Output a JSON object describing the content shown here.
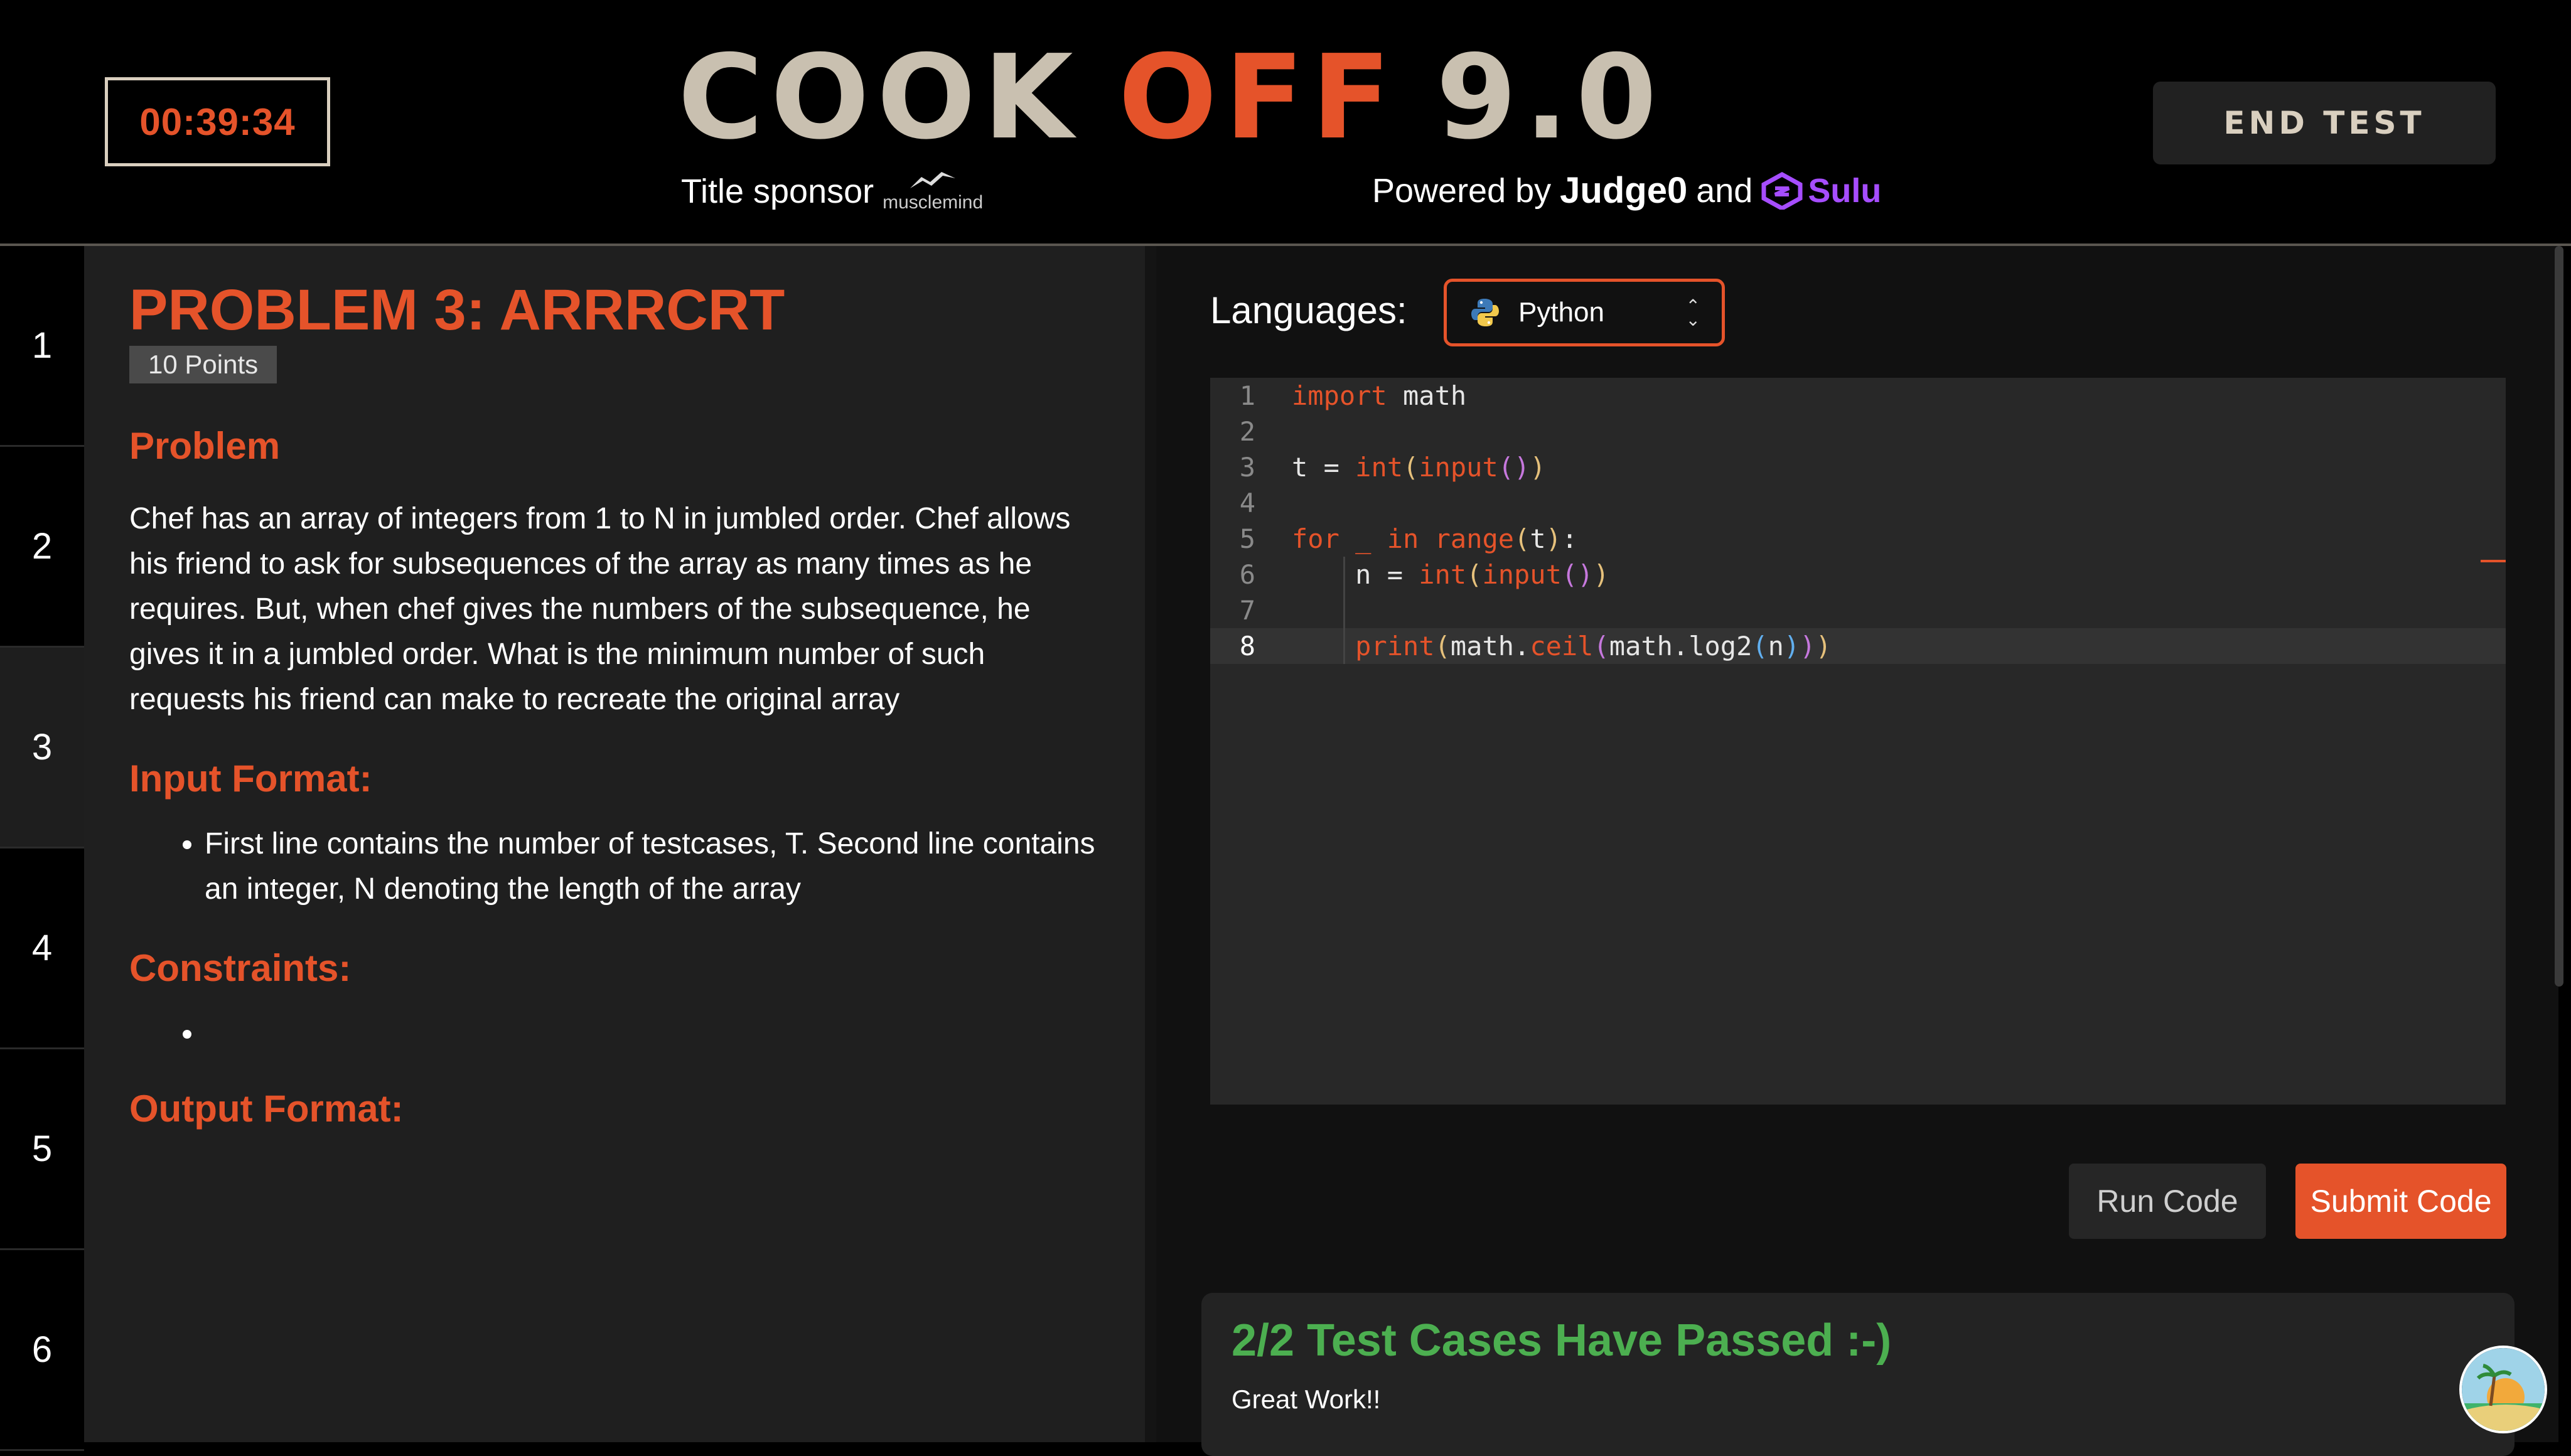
{
  "header": {
    "timer": "00:39:34",
    "logo_word1": "COOK",
    "logo_word2": "OFF",
    "logo_word3": "9.0",
    "title_sponsor_label": "Title sponsor",
    "sponsor_name": "musclemind",
    "powered_by": "Powered by",
    "judge_name": "Judge0",
    "and_text": "and",
    "sulu_name": "Sulu",
    "end_test_label": "END TEST"
  },
  "sidebar": {
    "items": [
      {
        "label": "1"
      },
      {
        "label": "2"
      },
      {
        "label": "3"
      },
      {
        "label": "4"
      },
      {
        "label": "5"
      },
      {
        "label": "6"
      }
    ],
    "active": "3"
  },
  "problem": {
    "title": "PROBLEM 3: ARRRCRT",
    "points": "10 Points",
    "problem_heading": "Problem",
    "statement": "Chef has an array of integers from 1 to N in jumbled order. Chef allows his friend to ask for subsequences of the array as many times as he requires. But, when chef gives the numbers of the subsequence, he gives it in a jumbled order. What is the minimum number of such requests his friend can make to recreate the original array",
    "input_heading": "Input Format:",
    "input_items": [
      "First line contains the number of testcases, T. Second line contains an integer, N denoting the length of the array"
    ],
    "constraints_heading": "Constraints:",
    "output_heading": "Output Format:"
  },
  "editor": {
    "languages_label": "Languages:",
    "selected_language": "Python",
    "code_lines": [
      "import math",
      "",
      "t = int(input())",
      "",
      "for _ in range(t):",
      "    n = int(input())",
      "",
      "    print(math.ceil(math.log2(n)))"
    ],
    "current_line": 8,
    "run_label": "Run Code",
    "submit_label": "Submit Code"
  },
  "result": {
    "title": "2/2 Test Cases Have Passed :-)",
    "subtitle": "Great Work!!"
  },
  "colors": {
    "accent": "#e5532a",
    "success": "#4caf50",
    "sulu": "#a64dff",
    "logo_beige": "#c9c0b0"
  },
  "icons": [
    "python-icon",
    "chevron-updown-icon",
    "musclemind-logo",
    "sulu-logo",
    "avatar"
  ]
}
